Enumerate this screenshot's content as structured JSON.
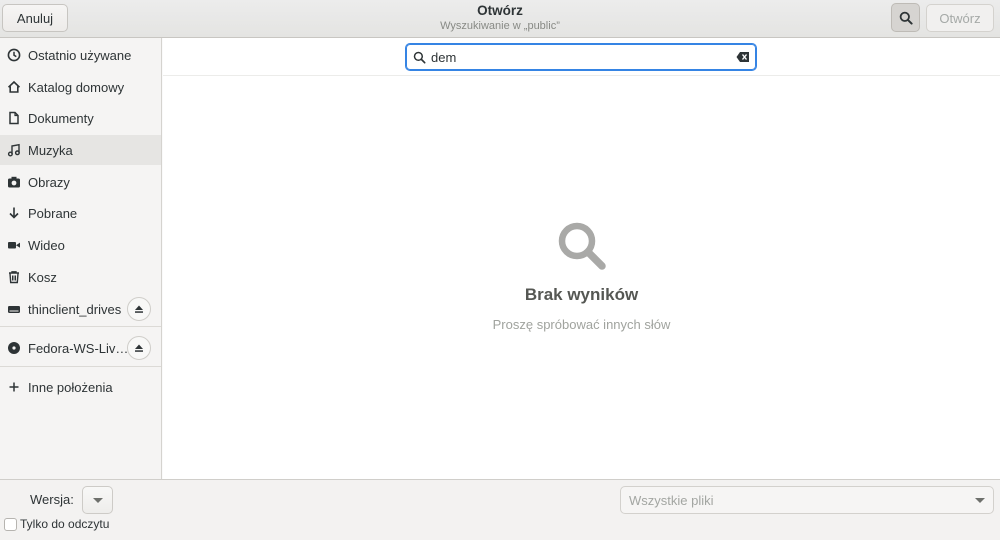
{
  "header": {
    "title": "Otwórz",
    "subtitle": "Wyszukiwanie w „public”",
    "cancel_label": "Anuluj",
    "open_label": "Otwórz",
    "search_toggle_icon": "search-icon"
  },
  "sidebar": {
    "items": [
      {
        "label": "Ostatnio używane",
        "icon": "clock-icon"
      },
      {
        "label": "Katalog domowy",
        "icon": "home-icon"
      },
      {
        "label": "Dokumenty",
        "icon": "document-icon"
      },
      {
        "label": "Muzyka",
        "icon": "music-icon"
      },
      {
        "label": "Obrazy",
        "icon": "camera-icon"
      },
      {
        "label": "Pobrane",
        "icon": "download-icon"
      },
      {
        "label": "Wideo",
        "icon": "video-icon"
      },
      {
        "label": "Kosz",
        "icon": "trash-icon"
      },
      {
        "label": "thinclient_drives",
        "icon": "drive-icon"
      },
      {
        "label": "Fedora-WS-Liv…",
        "icon": "disc-icon"
      },
      {
        "label": "Inne położenia",
        "icon": "plus-icon"
      }
    ],
    "selected": "Muzyka"
  },
  "search": {
    "value": "dem",
    "clear_icon": "backspace-icon"
  },
  "empty_state": {
    "icon": "magnifier-icon",
    "title": "Brak wyników",
    "subtitle": "Proszę spróbować innych słów"
  },
  "footer": {
    "version_label": "Wersja:",
    "readonly_label": "Tylko do odczytu",
    "readonly_checked": false,
    "filter_value": "Wszystkie pliki"
  },
  "colors": {
    "accent": "#3584e4",
    "selected_row": "#e6e5e3"
  }
}
